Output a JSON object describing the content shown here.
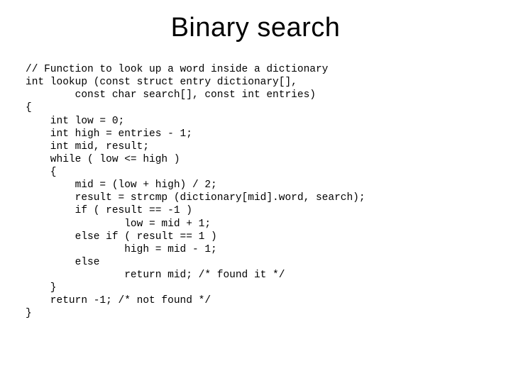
{
  "title": "Binary search",
  "code_lines": [
    "// Function to look up a word inside a dictionary",
    "int lookup (const struct entry dictionary[],",
    "        const char search[], const int entries)",
    "{",
    "    int low = 0;",
    "    int high = entries - 1;",
    "    int mid, result;",
    "    while ( low <= high )",
    "    {",
    "        mid = (low + high) / 2;",
    "        result = strcmp (dictionary[mid].word, search);",
    "        if ( result == -1 )",
    "                low = mid + 1;",
    "        else if ( result == 1 )",
    "                high = mid - 1;",
    "        else",
    "                return mid; /* found it */",
    "    }",
    "    return -1; /* not found */",
    "}"
  ]
}
